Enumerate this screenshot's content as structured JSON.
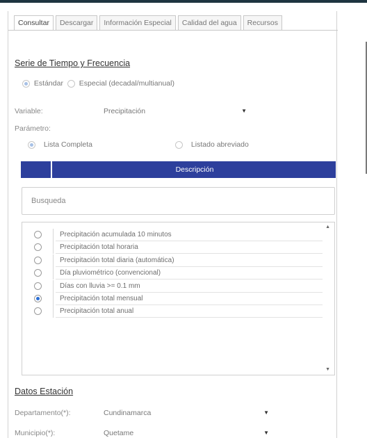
{
  "tabs": [
    "Consultar",
    "Descargar",
    "Información Especial",
    "Calidad del agua",
    "Recursos"
  ],
  "serie": {
    "title": "Serie de Tiempo y Frecuencia",
    "option_standard": "Estándar",
    "option_special": "Especial (decadal/multianual)"
  },
  "variable": {
    "label": "Variable:",
    "value": "Precipitación"
  },
  "parametro": {
    "label": "Parámetro:",
    "option_full": "Lista Completa",
    "option_short": "Listado abreviado"
  },
  "table": {
    "header": "Descripción",
    "search_placeholder": "Busqueda",
    "items": [
      {
        "label": "Precipitación acumulada 10 minutos",
        "selected": false
      },
      {
        "label": "Precipitación total horaria",
        "selected": false
      },
      {
        "label": "Precipitación total diaria (automática)",
        "selected": false
      },
      {
        "label": "Día pluviométrico (convencional)",
        "selected": false
      },
      {
        "label": "Días con lluvia >= 0.1 mm",
        "selected": false
      },
      {
        "label": "Precipitación total mensual",
        "selected": true
      },
      {
        "label": "Precipitación total anual",
        "selected": false
      }
    ]
  },
  "estacion": {
    "title": "Datos Estación",
    "departamento_label": "Departamento(*):",
    "departamento_value": "Cundinamarca",
    "municipio_label": "Municipio(*):",
    "municipio_value": "Quetame"
  },
  "colors": {
    "header_bar": "#2d3f9c",
    "radio_selected": "#2a6fd6",
    "top_strip": "#1e3440"
  }
}
